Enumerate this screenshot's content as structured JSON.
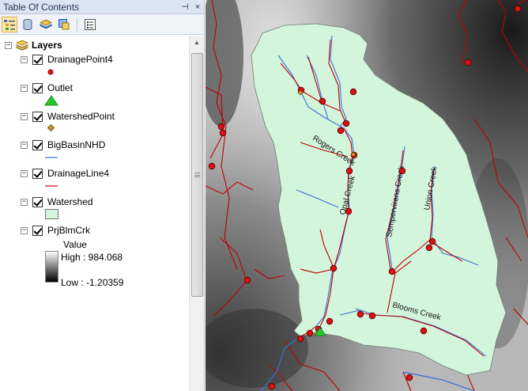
{
  "window": {
    "title": "Table Of Contents",
    "pin_glyph": "⊣",
    "close_glyph": "×"
  },
  "toolbar": {
    "tools": [
      {
        "name": "list-by-drawing-order",
        "active": true
      },
      {
        "name": "list-by-source",
        "active": false
      },
      {
        "name": "list-by-visibility",
        "active": false
      },
      {
        "name": "list-by-selection",
        "active": false
      },
      {
        "name": "options",
        "active": false
      }
    ]
  },
  "toc": {
    "root": {
      "label": "Layers",
      "expander": "−"
    },
    "layers": [
      {
        "label": "DrainagePoint4",
        "checked": true,
        "symbol": "red-dot",
        "expander": "−"
      },
      {
        "label": "Outlet",
        "checked": true,
        "symbol": "green-triangle",
        "expander": "−"
      },
      {
        "label": "WatershedPoint",
        "checked": true,
        "symbol": "orange-diamond",
        "expander": "−"
      },
      {
        "label": "BigBasinNHD",
        "checked": true,
        "symbol": "blue-line",
        "expander": "−"
      },
      {
        "label": "DrainageLine4",
        "checked": true,
        "symbol": "red-line",
        "expander": "−"
      },
      {
        "label": "Watershed",
        "checked": true,
        "symbol": "green-fill",
        "expander": "−"
      },
      {
        "label": "PrjBlmCrk",
        "checked": true,
        "symbol": "grayscale-ramp",
        "expander": "−"
      }
    ],
    "raster_legend": {
      "value_label": "Value",
      "high_label": "High : 984.068",
      "low_label": "Low : -1.20359"
    }
  },
  "map": {
    "creek_labels": [
      "Rogers Creek",
      "Opal Creek",
      "Sempervirens Creek",
      "Union Creek",
      "Blooms Creek"
    ]
  },
  "colors": {
    "watershed_fill": "#d3f5dc",
    "drainage_line": "#d40000",
    "nhd_line": "#3d6fd6",
    "drainage_point": "#e01010",
    "outlet": "#22cc22"
  }
}
